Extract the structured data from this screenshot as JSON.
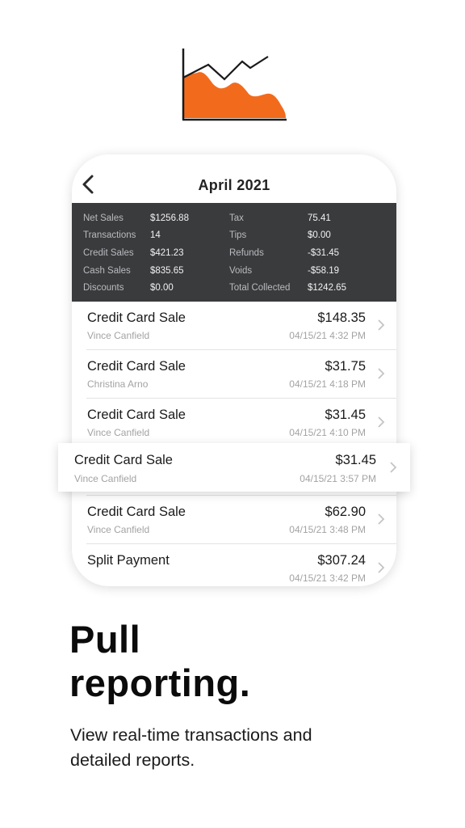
{
  "hero": {
    "icon": "area-chart-icon",
    "colors": {
      "fill": "#f26b1d",
      "stroke": "#1a1a1a"
    }
  },
  "screen": {
    "title": "April 2021",
    "back_icon": "chevron-left-icon",
    "summary": {
      "left": [
        {
          "label": "Net Sales",
          "value": "$1256.88"
        },
        {
          "label": "Transactions",
          "value": "14"
        },
        {
          "label": "Credit Sales",
          "value": "$421.23"
        },
        {
          "label": "Cash Sales",
          "value": "$835.65"
        },
        {
          "label": "Discounts",
          "value": "$0.00"
        }
      ],
      "right": [
        {
          "label": "Tax",
          "value": "75.41"
        },
        {
          "label": "Tips",
          "value": "$0.00"
        },
        {
          "label": "Refunds",
          "value": "-$31.45"
        },
        {
          "label": "Voids",
          "value": "-$58.19"
        },
        {
          "label": "Total Collected",
          "value": "$1242.65"
        }
      ]
    },
    "transactions": [
      {
        "type": "Credit Card Sale",
        "person": "Vince Canfield",
        "amount": "$148.35",
        "time": "04/15/21 4:32 PM"
      },
      {
        "type": "Credit Card Sale",
        "person": "Christina Arno",
        "amount": "$31.75",
        "time": "04/15/21 4:18 PM"
      },
      {
        "type": "Credit Card Sale",
        "person": "Vince Canfield",
        "amount": "$31.45",
        "time": "04/15/21 4:10 PM"
      },
      {
        "type": "Credit Card Sale",
        "person": "Vince Canfield",
        "amount": "$31.45",
        "time": "04/15/21 3:57 PM",
        "highlighted": true
      },
      {
        "type": "Credit Card Sale",
        "person": "Vince Canfield",
        "amount": "$62.90",
        "time": "04/15/21 3:48 PM"
      },
      {
        "type": "Split Payment",
        "person": "",
        "amount": "$307.24",
        "time": "04/15/21 3:42 PM"
      }
    ]
  },
  "marketing": {
    "headline_line1": "Pull",
    "headline_line2": "reporting.",
    "subtext_line1": "View real-time transactions and",
    "subtext_line2": "detailed reports."
  }
}
